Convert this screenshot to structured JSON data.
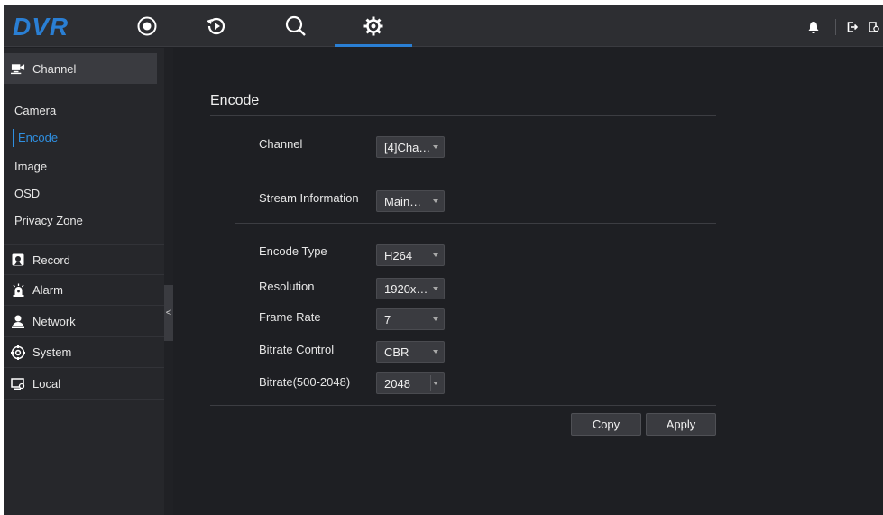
{
  "app": {
    "logo": "DVR"
  },
  "nav": {
    "tabs": [
      {
        "name": "live-view",
        "icon": "live-view-icon"
      },
      {
        "name": "playback",
        "icon": "playback-icon"
      },
      {
        "name": "search",
        "icon": "search-icon"
      },
      {
        "name": "settings",
        "icon": "gear-icon",
        "active": true
      }
    ],
    "right_icons": [
      "bell-icon",
      "logout-icon",
      "lock-screen-icon"
    ]
  },
  "sidebar": {
    "groups": [
      {
        "label": "Channel",
        "icon": "camera-icon",
        "expanded": true
      },
      {
        "label": "Record",
        "icon": "record-icon"
      },
      {
        "label": "Alarm",
        "icon": "alarm-icon"
      },
      {
        "label": "Network",
        "icon": "network-icon"
      },
      {
        "label": "System",
        "icon": "system-icon"
      },
      {
        "label": "Local",
        "icon": "local-icon"
      }
    ],
    "channel_items": [
      {
        "label": "Camera"
      },
      {
        "label": "Encode",
        "selected": true
      },
      {
        "label": "Image"
      },
      {
        "label": "OSD"
      },
      {
        "label": "Privacy Zone"
      }
    ],
    "collapse_label": "<"
  },
  "encode": {
    "title": "Encode",
    "fields": {
      "channel": {
        "label": "Channel",
        "value": "[4]Cha…"
      },
      "stream": {
        "label": "Stream Information",
        "value": "Main…"
      },
      "encode_type": {
        "label": "Encode Type",
        "value": "H264"
      },
      "resolution": {
        "label": "Resolution",
        "value": "1920x…"
      },
      "frame_rate": {
        "label": "Frame Rate",
        "value": "7"
      },
      "bitrate_control": {
        "label": "Bitrate Control",
        "value": "CBR"
      },
      "bitrate": {
        "label": "Bitrate(500-2048)",
        "value": "2048"
      }
    },
    "buttons": {
      "copy": "Copy",
      "apply": "Apply"
    }
  },
  "colors": {
    "accent": "#2a7fd4",
    "background": "#1e1f23",
    "sidebar": "#26272b",
    "topbar": "#2d2e32"
  }
}
